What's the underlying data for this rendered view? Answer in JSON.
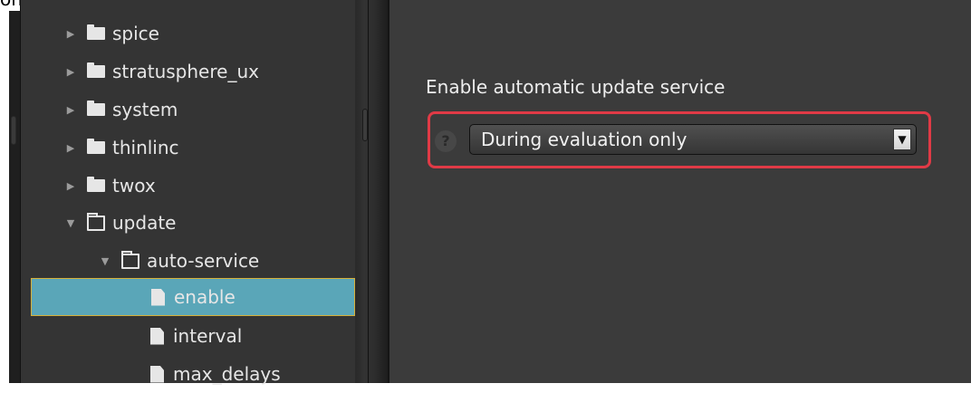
{
  "top_fragment": "only\".",
  "tree": {
    "items": [
      {
        "label": "spice",
        "type": "folder-closed",
        "expanded": false
      },
      {
        "label": "stratusphere_ux",
        "type": "folder-closed",
        "expanded": false
      },
      {
        "label": "system",
        "type": "folder-closed",
        "expanded": false
      },
      {
        "label": "thinlinc",
        "type": "folder-closed",
        "expanded": false
      },
      {
        "label": "twox",
        "type": "folder-closed",
        "expanded": false
      },
      {
        "label": "update",
        "type": "folder-open",
        "expanded": true
      },
      {
        "label": "auto-service",
        "type": "folder-open",
        "expanded": true
      },
      {
        "label": "enable",
        "type": "file",
        "selected": true
      },
      {
        "label": "interval",
        "type": "file"
      },
      {
        "label": "max_delays",
        "type": "file"
      }
    ]
  },
  "setting": {
    "label": "Enable automatic update service",
    "value": "During evaluation only",
    "help_glyph": "?",
    "dropdown_glyph": "▼"
  },
  "colors": {
    "selection": "#5aa6b8",
    "highlight": "#e03a46",
    "panel": "#3b3b3b"
  }
}
